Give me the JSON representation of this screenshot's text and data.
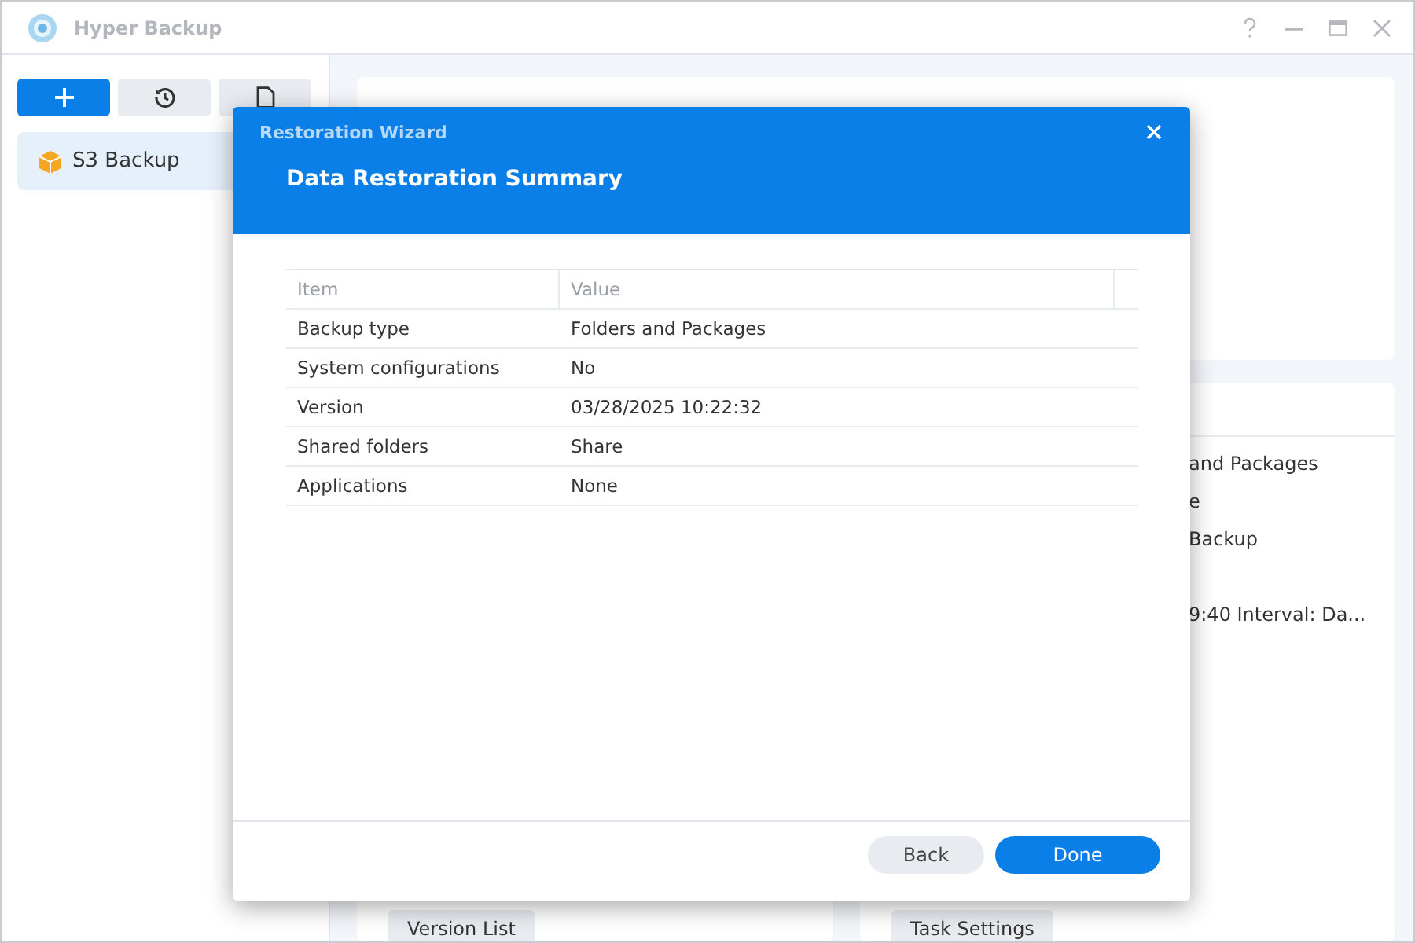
{
  "window": {
    "title": "Hyper Backup"
  },
  "sidebar": {
    "items": [
      {
        "label": "S3 Backup",
        "selected": true
      }
    ]
  },
  "task_details": {
    "lines": [
      "and Packages",
      "e",
      "Backup",
      "9:40 Interval: Da..."
    ]
  },
  "buttons": [
    "Version List",
    "Task Settings"
  ],
  "dialog": {
    "title": "Restoration Wizard",
    "heading": "Data Restoration Summary",
    "table": {
      "columns": [
        "Item",
        "Value"
      ],
      "rows": [
        [
          "Backup type",
          "Folders and Packages"
        ],
        [
          "System configurations",
          "No"
        ],
        [
          "Version",
          "03/28/2025 10:22:32"
        ],
        [
          "Shared folders",
          "Share"
        ],
        [
          "Applications",
          "None"
        ]
      ]
    },
    "buttons": [
      {
        "label": "Back",
        "kind": "secondary"
      },
      {
        "label": "Done",
        "kind": "primary"
      }
    ]
  }
}
